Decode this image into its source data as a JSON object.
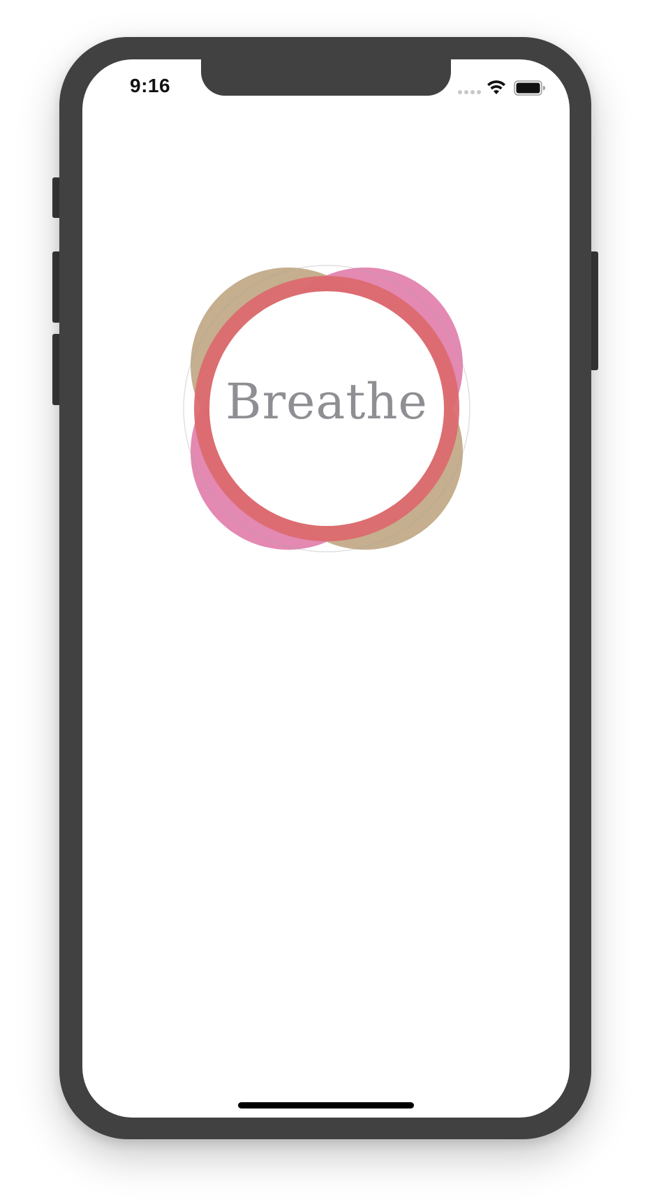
{
  "status_bar": {
    "time": "9:16",
    "signal_icon": "cellular-dots-icon",
    "wifi_icon": "wifi-icon",
    "battery_icon": "battery-full-icon"
  },
  "main": {
    "title": "Breathe",
    "petal_colors": [
      "#c2ab88",
      "#de74a5",
      "#dc6a6f"
    ],
    "background": "#ffffff",
    "text_color": "#8e8e93"
  },
  "device": {
    "frame_color": "#414141"
  }
}
